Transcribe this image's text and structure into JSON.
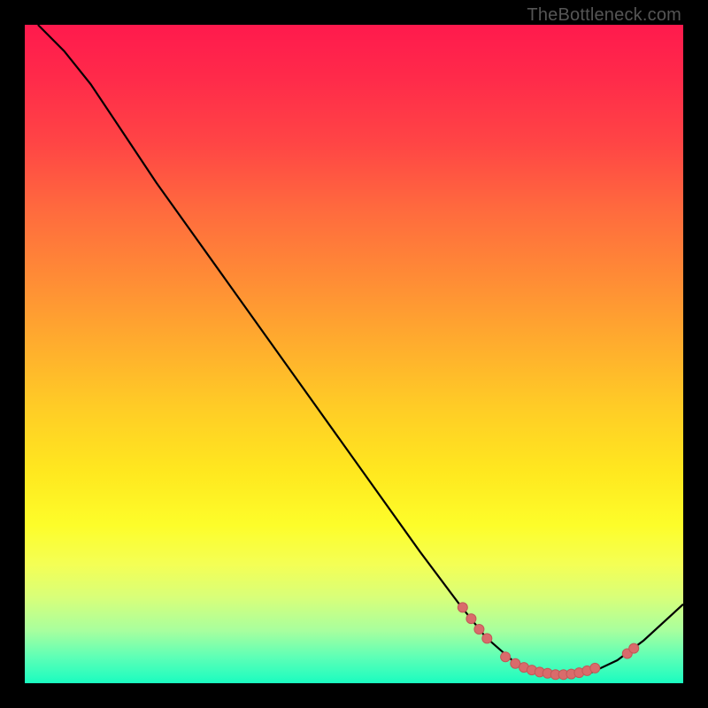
{
  "watermark": "TheBottleneck.com",
  "colors": {
    "curve": "#000000",
    "dot_fill": "#d96b6b",
    "dot_stroke": "#c25858"
  },
  "chart_data": {
    "type": "line",
    "title": "",
    "xlabel": "",
    "ylabel": "",
    "xlim": [
      0,
      100
    ],
    "ylim": [
      0,
      100
    ],
    "curve": [
      {
        "x": 2,
        "y": 100
      },
      {
        "x": 6,
        "y": 96
      },
      {
        "x": 10,
        "y": 91
      },
      {
        "x": 14,
        "y": 85
      },
      {
        "x": 20,
        "y": 76
      },
      {
        "x": 30,
        "y": 62
      },
      {
        "x": 40,
        "y": 48
      },
      {
        "x": 50,
        "y": 34
      },
      {
        "x": 60,
        "y": 20
      },
      {
        "x": 66,
        "y": 12
      },
      {
        "x": 70,
        "y": 7
      },
      {
        "x": 74,
        "y": 3.5
      },
      {
        "x": 78,
        "y": 1.6
      },
      {
        "x": 82,
        "y": 1.2
      },
      {
        "x": 86,
        "y": 1.6
      },
      {
        "x": 90,
        "y": 3.5
      },
      {
        "x": 94,
        "y": 6.5
      },
      {
        "x": 100,
        "y": 12
      }
    ],
    "points": [
      {
        "x": 66.5,
        "y": 11.5
      },
      {
        "x": 67.8,
        "y": 9.8
      },
      {
        "x": 69.0,
        "y": 8.2
      },
      {
        "x": 70.2,
        "y": 6.8
      },
      {
        "x": 73.0,
        "y": 4.0
      },
      {
        "x": 74.5,
        "y": 3.0
      },
      {
        "x": 75.8,
        "y": 2.4
      },
      {
        "x": 77.0,
        "y": 2.0
      },
      {
        "x": 78.2,
        "y": 1.7
      },
      {
        "x": 79.4,
        "y": 1.5
      },
      {
        "x": 80.6,
        "y": 1.3
      },
      {
        "x": 81.8,
        "y": 1.3
      },
      {
        "x": 83.0,
        "y": 1.4
      },
      {
        "x": 84.2,
        "y": 1.6
      },
      {
        "x": 85.4,
        "y": 1.9
      },
      {
        "x": 86.6,
        "y": 2.3
      },
      {
        "x": 91.5,
        "y": 4.5
      },
      {
        "x": 92.5,
        "y": 5.3
      }
    ]
  }
}
